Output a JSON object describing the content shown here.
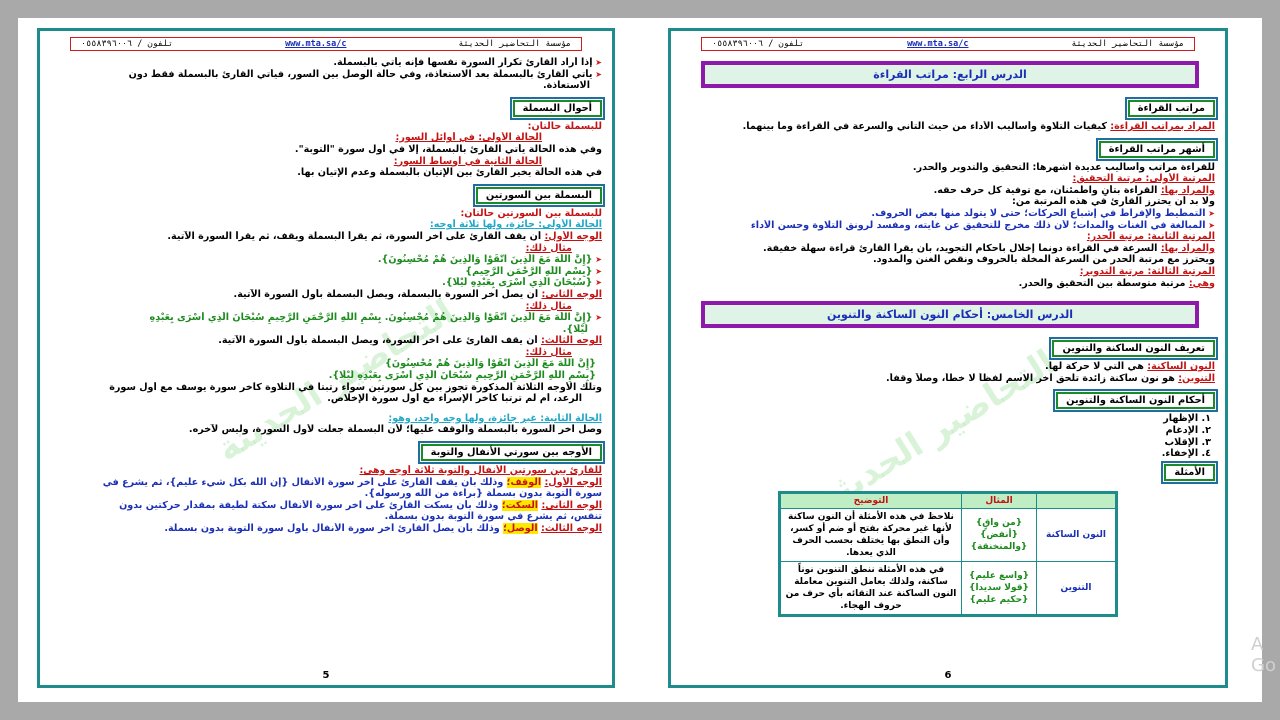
{
  "header": {
    "org": "مؤسسة التحاضير الحديثة",
    "site": "www.mta.sa/c",
    "phone": "تلفون / ٠٥٥٨٣٩٦٠٠٦"
  },
  "left": {
    "lines": [
      "إذا أراد القارئ تكرار السورة نفسها فإنه يأتي بالبسملة.",
      "يأتي القارئ بالبسملة بعد الاستعاذة، وفي حالة الوصل بين السور، فيأتي القارئ بالبسملة فقط دون",
      "الاستعاذة."
    ],
    "sec1": {
      "title": "أحوال البسملة",
      "sub": "للبسملة حالتان:",
      "c1": "الحالة الأولى: في أوائل السور:",
      "t1": "وفي هذه الحالة يأتي القارئ بالبسملة، إلا في أول سورة \"التوبة\".",
      "c2": "الحالة الثانية في أوساط السور:",
      "t2": "في هذه الحالة يخير القارئ بين الإتيان بالبسملة وعدم الإتيان بها."
    },
    "sec2": {
      "title": "البسملة بين السورتين",
      "sub": "للبسملة بين السورتين حالتان:",
      "c1": "الحالة الأولى: جائزة، ولها ثلاثة أوجه:",
      "w1a": "الوجه الأول:",
      "w1": "أن يقف القارئ على آخر السورة، ثم يقرأ البسملة ويقف، ثم يقرأ السورة الآتية.",
      "ex": "مثال ذلك:",
      "e1": "{إِنَّ اللَّهَ مَعَ الَّذِينَ اتَّقَوْا وَالَّذِينَ هُمْ مُحْسِنُونَ}.",
      "e2": "{بِسْمِ اللَّهِ الرَّحْمَنِ الرَّحِيمِ}",
      "e3": "{سُبْحَانَ الَّذِي أَسْرَى بِعَبْدِهِ لَيْلًا}.",
      "w2a": "الوجه الثاني:",
      "w2": "أن يصل آخر السورة بالبسملة، ويصل البسملة بأول السورة الآتية.",
      "e4": "{إِنَّ اللَّهَ مَعَ الَّذِينَ اتَّقَوْا وَالَّذِينَ هُمْ مُحْسِنُونَ. بِسْمِ اللَّهِ الرَّحْمَنِ الرَّحِيمِ     سُبْحَانَ الَّذِي أَسْرَى بِعَبْدِهِ",
      "e4b": "لَيْلًا}.",
      "w3a": "الوجه الثالث:",
      "w3": "أن يقف القارئ على آخر السورة، ويصل البسملة بأول السورة الآتية.",
      "e5": "{إِنَّ اللَّهَ مَعَ الَّذِينَ اتَّقَوْا وَالَّذِينَ هُمْ مُحْسِنُونَ}",
      "e6": "{بِسْمِ اللَّهِ الرَّحْمَنِ الرَّحِيمِ     سُبْحَانَ الَّذِي أَسْرَى بِعَبْدِهِ لَيْلًا}.",
      "n1": "وتلك الأوجه الثلاثة المذكورة تجوز بين كل سورتين سواء رتبتا في التلاوة كآخر سورة يوسف مع أول سورة",
      "n2": "الرعد، أم لم ترتبا كآخر الإسراء مع أول سورة الإخلاص.",
      "c2": "الحالة الثانية: غير جائزة، ولها وجه واحد، وهو:",
      "c2t": "وصل آخر السورة بالبسملة والوقف عليها؛ لأن البسملة جعلت لأول السورة، وليس لآخره."
    },
    "sec3": {
      "title": "الأوجه بين سورتي الأنفال والتوبة",
      "sub": "للقارئ بين سورتين الأنفال والتوبة ثلاثة أوجه وهي:",
      "w1a": "الوجه الأول:",
      "w1k": "الوقف؛",
      "w1": "وذلك بأن يقف القارئ على آخر سورة الأنفال {إن الله بكل شيء عليم}، ثم يشرع في",
      "w1b": "سورة التوبة بدون بسملة {براءة من الله ورسوله}.",
      "w2a": "الوجه الثاني:",
      "w2k": "السكت؛",
      "w2": "وذلك بأن يسكت القارئ على آخر سورة الأنفال سكتة لطيفة بمقدار حركتين بدون",
      "w2b": "تنفس، ثم يشرع في سورة التوبة بدون بسملة.",
      "w3a": "الوجه الثالث:",
      "w3k": "الوصل؛",
      "w3": "وذلك بأن يصل القارئ آخر سورة الأنفال بأول سورة التوبة بدون بسملة."
    },
    "page_number": "5"
  },
  "right": {
    "lesson4": "الدرس الرابع: مراتب القراءة",
    "s1": {
      "title": "مراتب القراءة",
      "k": "المراد بمراتب القراءة:",
      "t": "كيفيات التلاوة وأساليب الأداء من حيث التأني والسرعة في القراءة وما بينهما."
    },
    "s2": {
      "title": "أشهر مراتب القراءة",
      "l1": "للقراءة مراتب وأساليب عديدة أشهرها: التحقيق والتدوير والحدر.",
      "r1": "المرتبة الأولى: مرتبة التحقيق:",
      "m1a": "والمراد بها:",
      "m1": "القراءة بتأنٍ واطمئنان، مع توفية كل حرف حقه.",
      "l2": "ولا بد أن يحترز القارئ في هذه المرتبة من:",
      "b1": "التمطيط والإفراط في إشباع الحركات؛ حتى لا يتولد منها بعض الحروف.",
      "b2": "المبالغة في الغنات والمدات؛ لأن ذلك مخرج للتحقيق عن غايته، ومفسد لرونق التلاوة وحسن الأداء",
      "r2": "المرتبة الثانية: مرتبة الحدر:",
      "m2a": "والمراد بها:",
      "m2": "السرعة في القراءة دونما إخلال بأحكام التجويد، بأن يقرأ القارئ قراءة سهلة خفيفة.",
      "l3": "ويحترز مع مرتبة الحدر من السرعة المخلة بالحروف ونقص الغنن والمدود.",
      "r3": "المرتبة الثالثة: مرتبة التدوير:",
      "m3a": "وهي:",
      "m3": "مرتبة متوسطة بين التحقيق والحدر."
    },
    "lesson5": "الدرس الخامس: أحكام النون الساكنة والتنوين",
    "s3": {
      "title": "تعريف النون الساكنة والتنوين",
      "k1": "النون الساكنة:",
      "t1": "هي التي لا حركة لها.",
      "k2": "التنوين:",
      "t2": "هو نون ساكنة زائدة تلحق آخر الاسم لفظاً لا خطاً، وصلاً وقفاً."
    },
    "s4": {
      "title": "أحكام النون الساكنة والتنوين",
      "items": [
        "١. الإظهار",
        "٢. الإدغام",
        "٣. الإقلاب",
        "٤. الإخفاء."
      ]
    },
    "s5": {
      "title": "الأمثلة"
    },
    "table": {
      "h_example": "المثال",
      "h_explain": "التوضيح",
      "rows": [
        {
          "head": "النون الساكنة",
          "ex": [
            "{من واقٍ}",
            "{أنفض}",
            "{والمنخنقة}"
          ],
          "exp": "نلاحظ في هذه الأمثلة أن النون ساكنة لأنها غير محركة بفتح أو ضم أو كسر، وأن النطق بها يختلف بحسب الحرف الذي يعدها."
        },
        {
          "head": "التنوين",
          "ex": [
            "{واسع عليم}",
            "{قولا سديدا}",
            "{حكيم عليم}"
          ],
          "exp": "في هذه الأمثلة ننطق التنوين نوناً ساكنة، ولذلك يعامل التنوين معاملة النون الساكنة عند التقائه بأي حرف من حروف الهجاء."
        }
      ]
    },
    "page_number": "6"
  },
  "watermark": "التحاضير الحديثة",
  "side_text": "A\nGo"
}
